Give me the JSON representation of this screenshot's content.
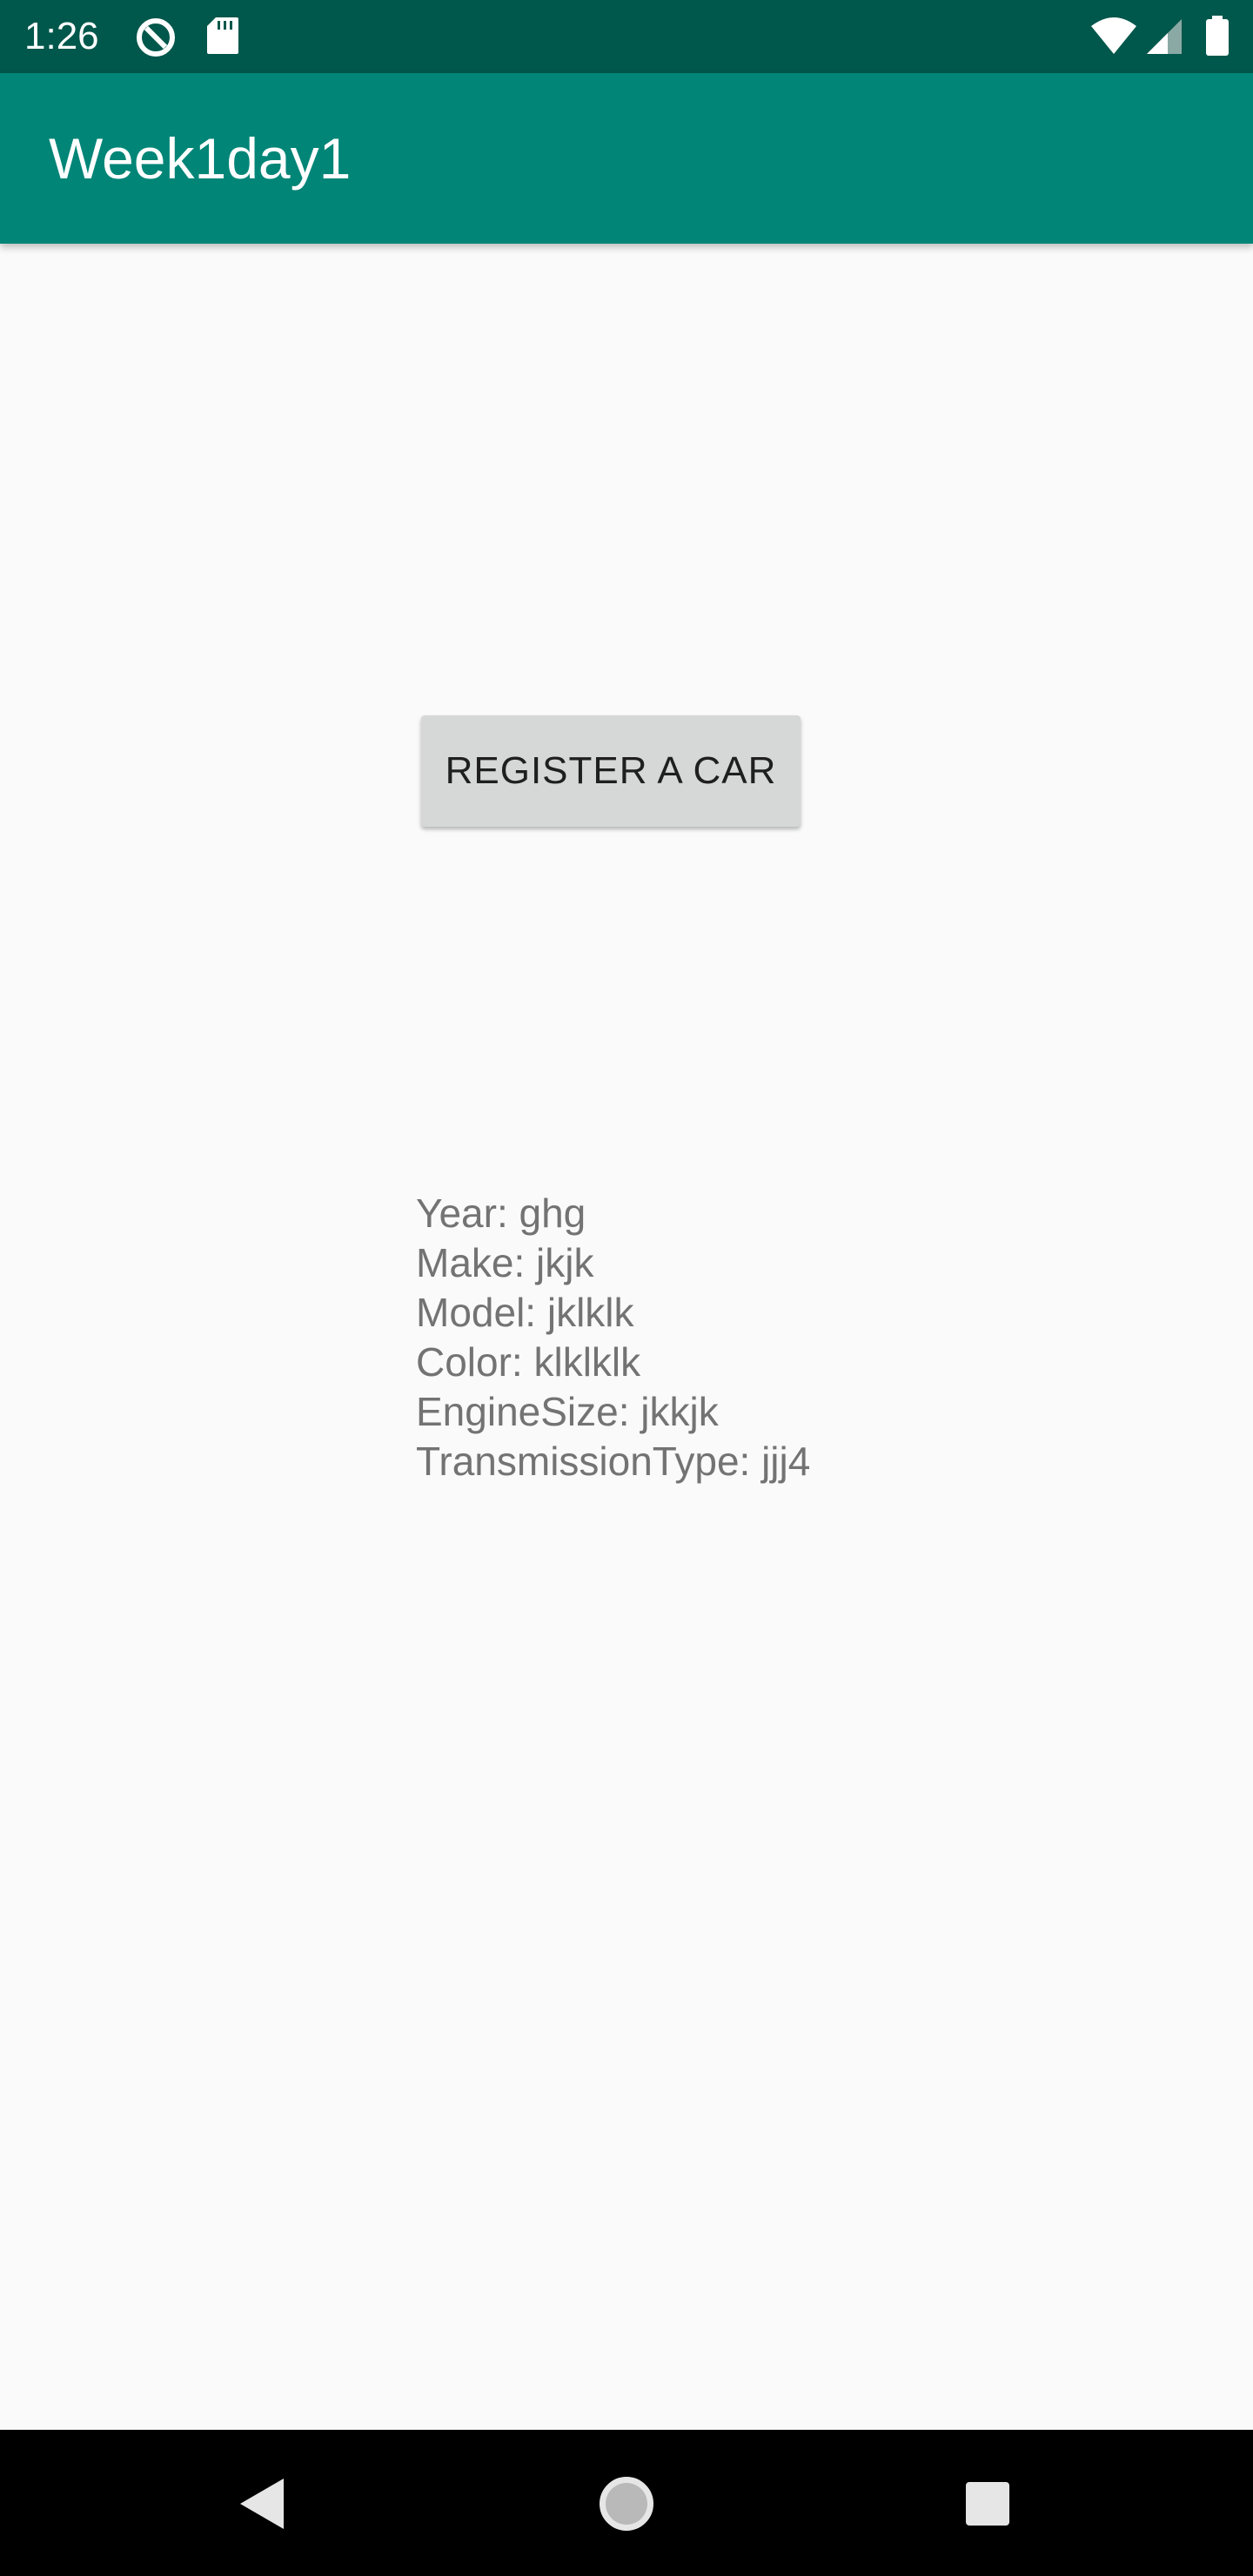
{
  "status_bar": {
    "time": "1:26",
    "background": "#00574b",
    "icons": [
      "data-saver-icon",
      "sd-card-icon",
      "wifi-icon",
      "signal-icon",
      "battery-icon"
    ]
  },
  "app_bar": {
    "title": "Week1day1",
    "background": "#008577"
  },
  "main": {
    "register_button_label": "REGISTER A CAR",
    "car_details": [
      "Year: ghg",
      "Make: jkjk",
      "Model: jklklk",
      "Color: klklklk",
      "EngineSize: jkkjk",
      "TransmissionType: jjj4"
    ]
  },
  "nav_bar": {
    "icons": [
      "back-icon",
      "home-icon",
      "recents-icon"
    ]
  }
}
